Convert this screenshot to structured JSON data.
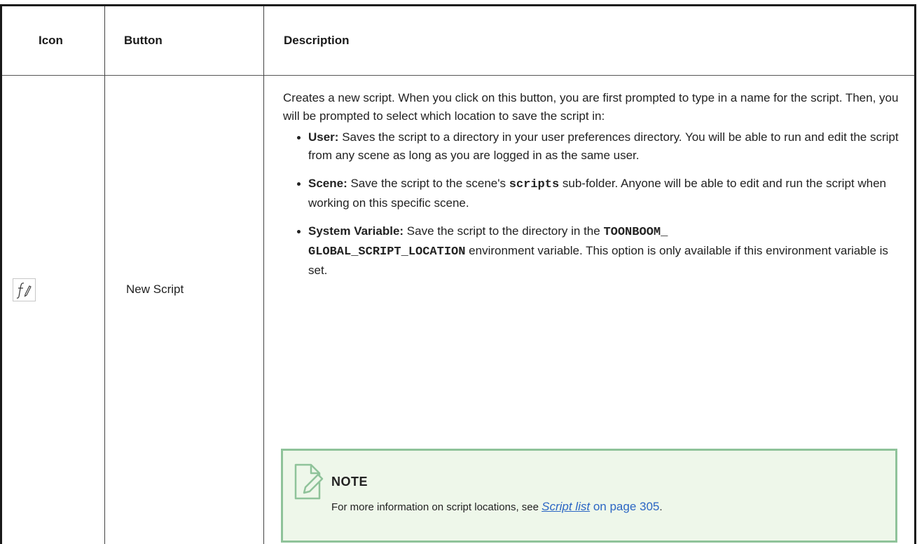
{
  "table": {
    "headers": {
      "icon": "Icon",
      "button": "Button",
      "description": "Description"
    },
    "row": {
      "icon_name": "new-script-icon",
      "button_label": "New Script",
      "description": {
        "intro": "Creates a new script. When you click on this button, you are first prompted to type in a name for the script. Then, you will be prompted to select which location to save the script in:",
        "bullets": {
          "user": {
            "label": "User:",
            "text": " Saves the script to a directory in your user preferences directory. You will be able to run and edit the script from any scene as long as you are logged in as the same user."
          },
          "scene": {
            "label": "Scene:",
            "text_before": " Save the script to the scene's ",
            "code": "scripts",
            "text_after": " sub-folder. Anyone will be able to edit and run the script when working on this specific scene."
          },
          "system": {
            "label": "System Variable:",
            "text_before": " Save the script to the directory in the ",
            "code_line1": "TOONBOOM_",
            "code_line2": "GLOBAL_SCRIPT_LOCATION",
            "text_after": " environment variable. This option is only available if this environment variable is set."
          }
        }
      },
      "note": {
        "title": "NOTE",
        "text_before": "For more information on script locations, see ",
        "link_text": "Script list",
        "page_text": " on page 305",
        "text_after": "."
      }
    }
  },
  "colors": {
    "note_background": "#eef7ea",
    "note_border": "#8fc39a",
    "link": "#2b66c4"
  }
}
